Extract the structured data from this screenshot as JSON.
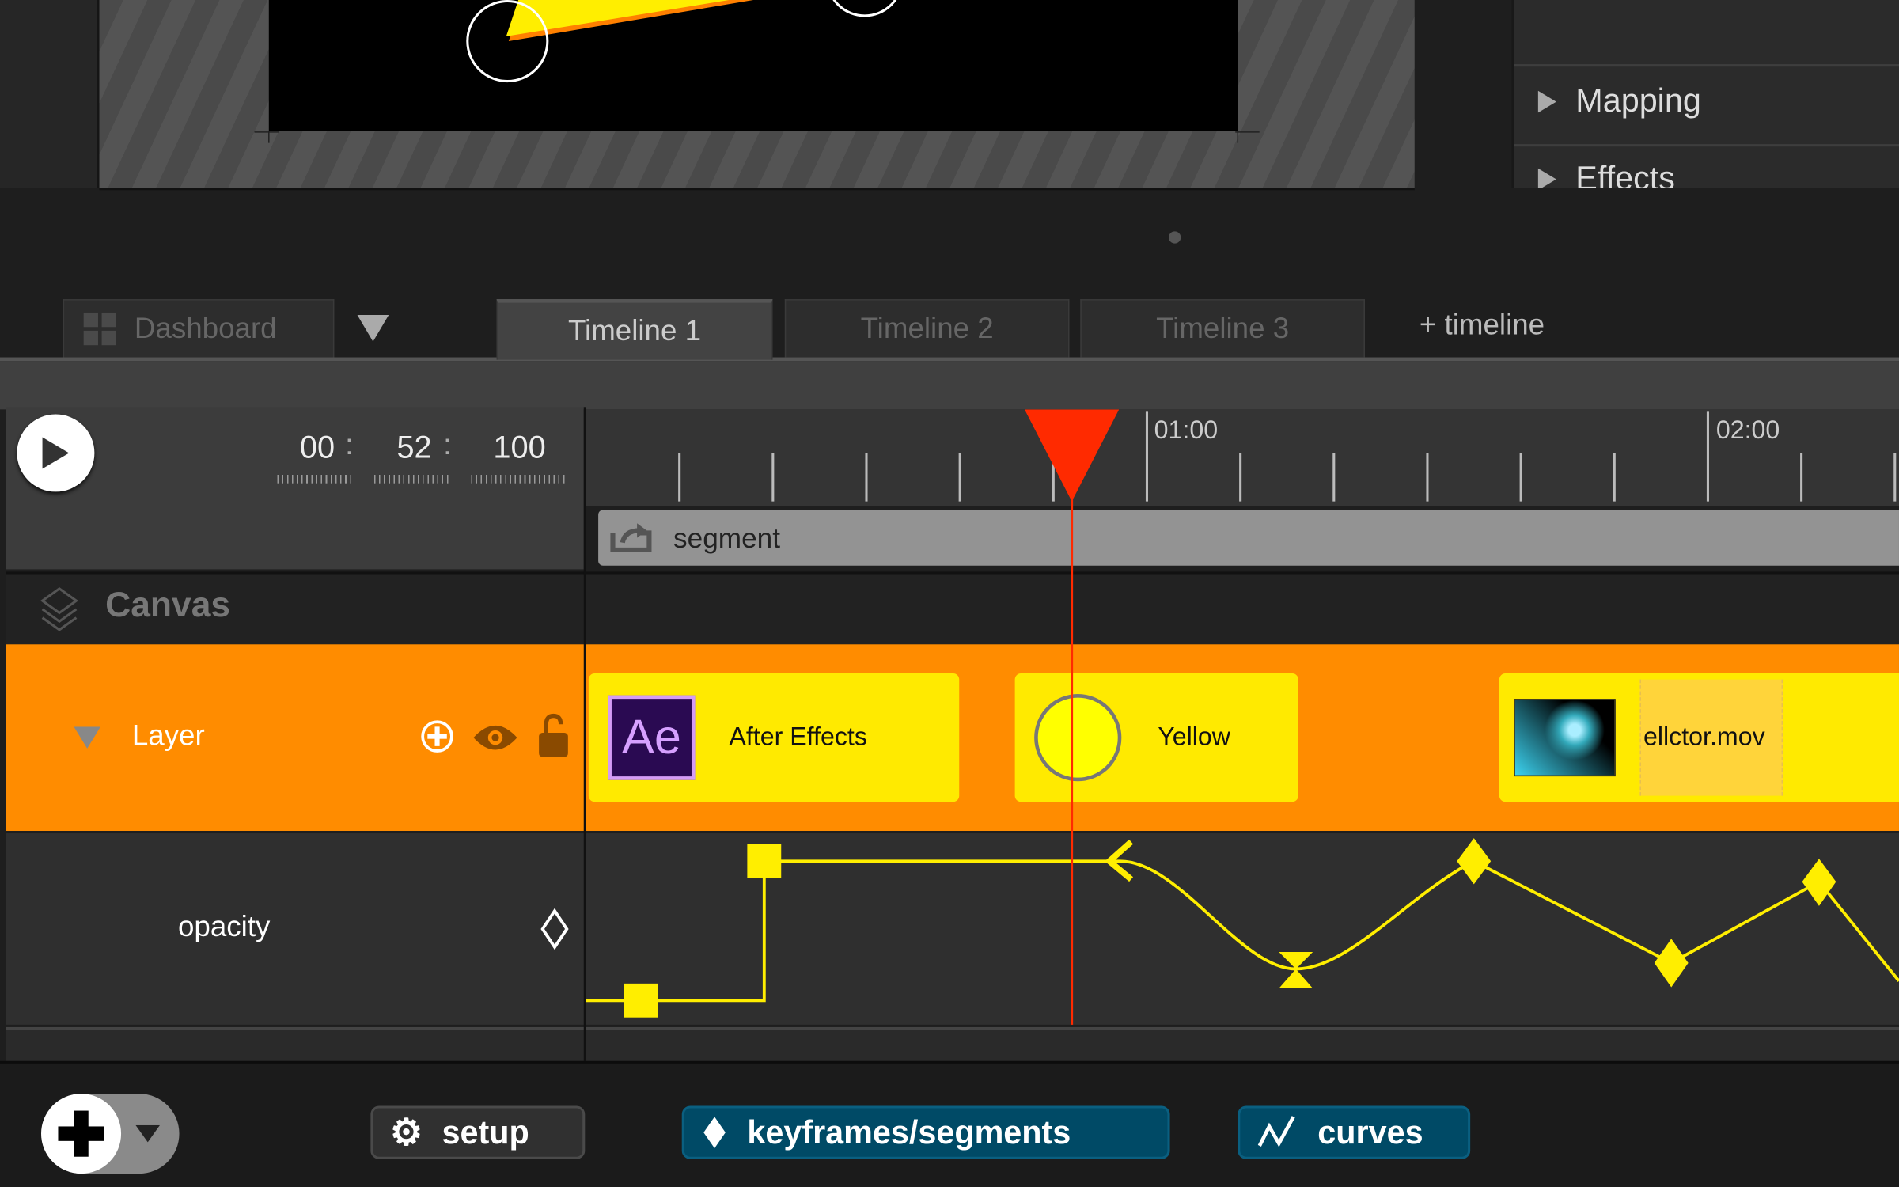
{
  "right_panel": {
    "items": [
      {
        "label": "Mapping"
      },
      {
        "label": "Effects"
      }
    ]
  },
  "tabs": {
    "dashboard": "Dashboard",
    "timelines": [
      "Timeline 1",
      "Timeline 2",
      "Timeline 3"
    ],
    "active": "Timeline 1",
    "add": "+ timeline"
  },
  "transport": {
    "minutes": "00",
    "seconds": "52",
    "millis": "100",
    "separator": ":"
  },
  "ruler": {
    "labels": [
      "01:00",
      "02:00"
    ],
    "playhead_time": "00:52:100"
  },
  "segment": {
    "label": "segment"
  },
  "layers": {
    "canvas": "Canvas",
    "layer": "Layer",
    "property": "opacity"
  },
  "clips": [
    {
      "label": "After Effects",
      "icon": "Ae"
    },
    {
      "label": "Yellow"
    },
    {
      "label": "ellctor.mov"
    }
  ],
  "toolbar": {
    "setup": "setup",
    "keyframes": "keyframes/segments",
    "curves": "curves"
  },
  "colors": {
    "layer": "#ff8c00",
    "clip": "#ffea00",
    "playhead": "#ff2a00",
    "curve": "#ffee00",
    "active_button": "#004a66"
  }
}
